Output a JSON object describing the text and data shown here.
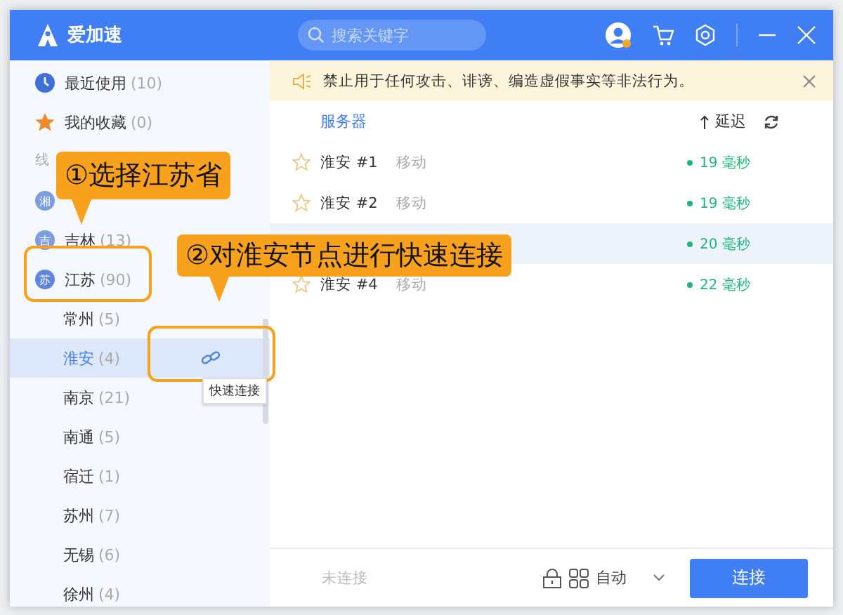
{
  "window": {
    "app_name": "爱加速",
    "search": {
      "placeholder": "搜索关键字"
    }
  },
  "notice": {
    "text": "禁止用于任何攻击、诽谤、编造虚假事实等非法行为。"
  },
  "sidebar": {
    "items": [
      {
        "kind": "recent",
        "label": "最近使用",
        "count": "(10)",
        "selected": false
      },
      {
        "kind": "favorite",
        "label": "我的收藏",
        "count": "(0)",
        "selected": false
      },
      {
        "kind": "group",
        "label": "线"
      },
      {
        "kind": "province",
        "badge": "湘",
        "expanded": false
      },
      {
        "kind": "province",
        "badge": "吉",
        "label": "吉林",
        "count": "(13)",
        "expanded": false
      },
      {
        "kind": "province",
        "badge": "苏",
        "label": "江苏",
        "count": "(90)",
        "expanded": true,
        "children": [
          {
            "label": "常州",
            "count": "(5)",
            "selected": false
          },
          {
            "label": "淮安",
            "count": "(4)",
            "selected": true,
            "tooltip": "快速连接"
          },
          {
            "label": "南京",
            "count": "(21)",
            "selected": false
          },
          {
            "label": "南通",
            "count": "(5)",
            "selected": false
          },
          {
            "label": "宿迁",
            "count": "(1)",
            "selected": false
          },
          {
            "label": "苏州",
            "count": "(7)",
            "selected": false
          },
          {
            "label": "无锡",
            "count": "(6)",
            "selected": false
          },
          {
            "label": "徐州",
            "count": "(4)",
            "selected": false
          }
        ]
      }
    ]
  },
  "server_list": {
    "column_server": "服务器",
    "column_latency": "延迟",
    "rows": [
      {
        "name": "淮安 #1",
        "carrier": "移动",
        "latency": "19 毫秒",
        "favorite": false,
        "selected": false
      },
      {
        "name": "淮安 #2",
        "carrier": "移动",
        "latency": "19 毫秒",
        "favorite": false,
        "selected": false
      },
      {
        "latency": "20 毫秒",
        "selected": true
      },
      {
        "name": "淮安 #4",
        "carrier": "移动",
        "latency": "22 毫秒",
        "favorite": false,
        "selected": false
      }
    ]
  },
  "footer": {
    "status": "未连接",
    "mode": "自动",
    "connect_button": "连接"
  },
  "annotations": [
    {
      "kind": "callout",
      "text": "①选择江苏省"
    },
    {
      "kind": "callout",
      "text": "②对淮安节点进行快速连接"
    }
  ]
}
